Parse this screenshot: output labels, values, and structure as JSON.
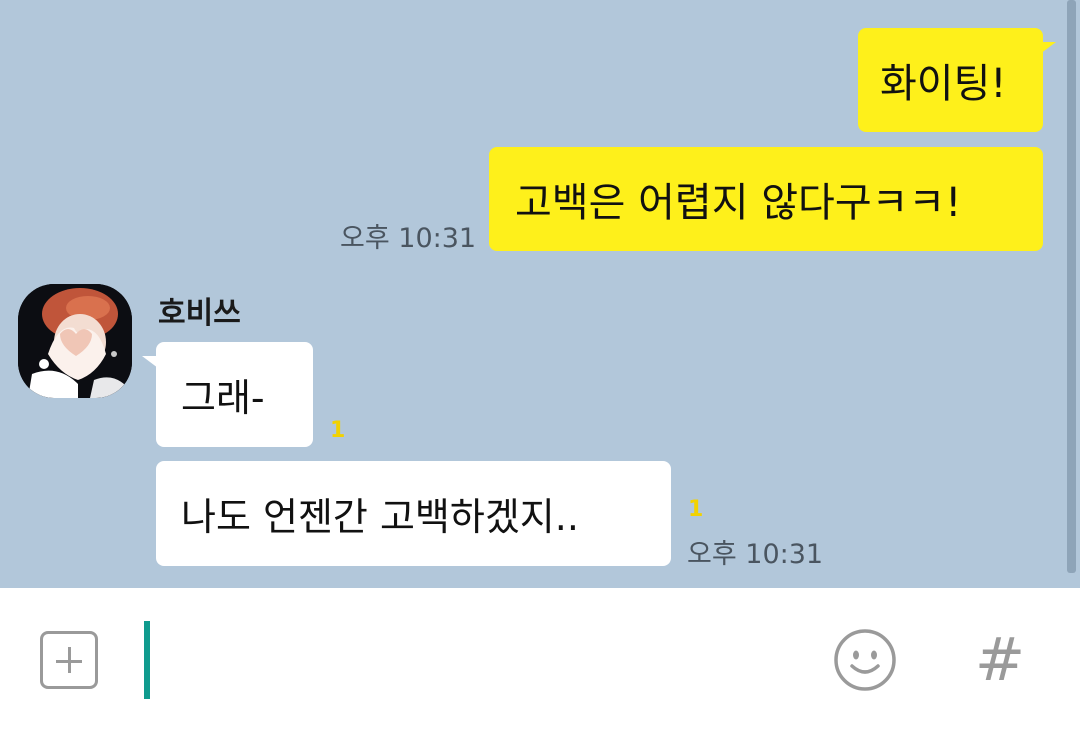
{
  "conversation": {
    "outgoing": [
      {
        "text": "화이팅!"
      },
      {
        "text": "고백은 어렵지 않다구ㅋㅋ!",
        "time": "오후 10:31"
      }
    ],
    "incoming": {
      "sender": "호비쓰",
      "messages": [
        {
          "text": "그래-",
          "unread": "1"
        },
        {
          "text": "나도 언젠간 고백하겠지..",
          "unread": "1",
          "time": "오후 10:31"
        }
      ]
    }
  },
  "input": {
    "value": "",
    "placeholder": "",
    "attach_icon": "plus-square-icon",
    "emoji_icon": "smiley-icon",
    "hash_label": "#"
  },
  "colors": {
    "chat_background": "#b2c7da",
    "my_bubble": "#fef01b",
    "other_bubble": "#ffffff",
    "unread_count": "#f2d200",
    "cursor": "#0f9b8e"
  }
}
